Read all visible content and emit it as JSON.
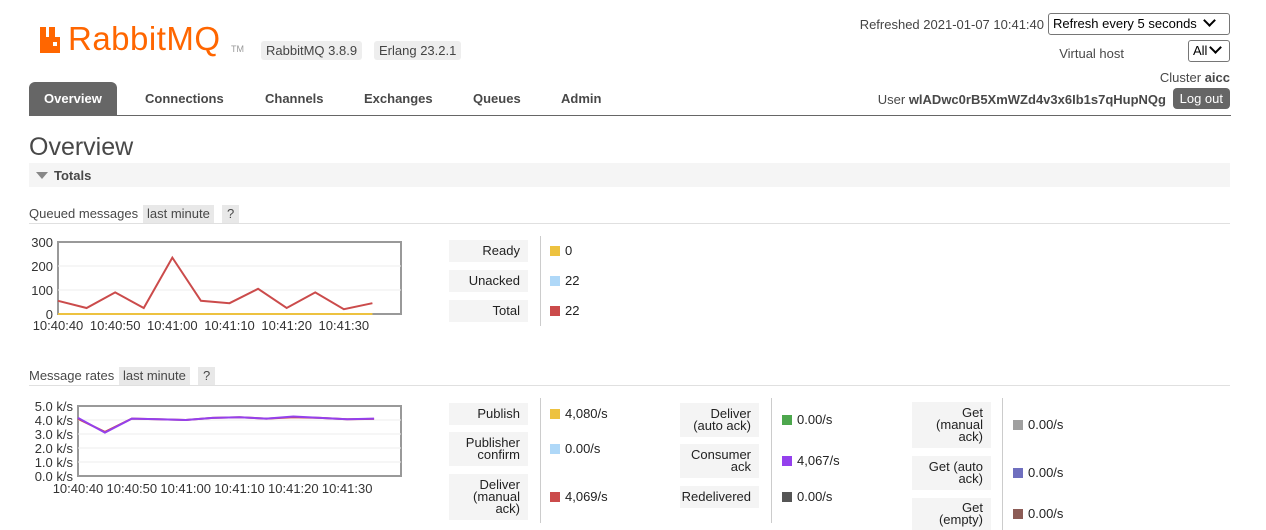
{
  "header": {
    "logo_text": "RabbitMQ",
    "logo_tm": "TM",
    "rabbitmq_version": "RabbitMQ 3.8.9",
    "erlang_version": "Erlang 23.2.1",
    "refreshed": "Refreshed 2021-01-07 10:41:40",
    "refresh_select": "Refresh every 5 seconds",
    "virtual_host_label": "Virtual host",
    "virtual_host_value": "All",
    "cluster_label": "Cluster",
    "cluster_name": "aicc",
    "user_label": "User",
    "user_name": "wlADwc0rB5XmWZd4v3x6Ib1s7qHupNQg",
    "logout_label": "Log out",
    "brand_color": "#ff6600"
  },
  "tabs": [
    {
      "label": "Overview",
      "active": true
    },
    {
      "label": "Connections"
    },
    {
      "label": "Channels"
    },
    {
      "label": "Exchanges"
    },
    {
      "label": "Queues"
    },
    {
      "label": "Admin"
    }
  ],
  "page": {
    "title": "Overview",
    "totals_label": "Totals"
  },
  "queued": {
    "label": "Queued messages",
    "range": "last minute",
    "help": "?",
    "stats": [
      {
        "label": "Ready",
        "value": "0",
        "color": "#edc240"
      },
      {
        "label": "Unacked",
        "value": "22",
        "color": "#afd8f8"
      },
      {
        "label": "Total",
        "value": "22",
        "color": "#cb4b4b"
      }
    ]
  },
  "rates": {
    "label": "Message rates",
    "range": "last minute",
    "help": "?",
    "col1": [
      {
        "label": "Publish",
        "value": "4,080/s",
        "color": "#edc240"
      },
      {
        "label": "Publisher confirm",
        "value": "0.00/s",
        "color": "#afd8f8"
      },
      {
        "label": "Deliver (manual ack)",
        "value": "4,069/s",
        "color": "#cb4b4b"
      }
    ],
    "col2": [
      {
        "label": "Deliver (auto ack)",
        "value": "0.00/s",
        "color": "#4da74d"
      },
      {
        "label": "Consumer ack",
        "value": "4,067/s",
        "color": "#9440ed"
      },
      {
        "label": "Redelivered",
        "value": "0.00/s",
        "color": "#555555"
      }
    ],
    "col3": [
      {
        "label": "Get (manual ack)",
        "value": "0.00/s",
        "color": "#a0a0a0"
      },
      {
        "label": "Get (auto ack)",
        "value": "0.00/s",
        "color": "#6f6fbf"
      },
      {
        "label": "Get (empty)",
        "value": "0.00/s",
        "color": "#8c5c56"
      }
    ]
  },
  "chart_data": [
    {
      "type": "line",
      "x": [
        "10:40:40",
        "10:40:45",
        "10:40:50",
        "10:40:55",
        "10:41:00",
        "10:41:05",
        "10:41:10",
        "10:41:15",
        "10:41:20",
        "10:41:25",
        "10:41:30",
        "10:41:35",
        "10:41:40"
      ],
      "x_ticks": [
        "10:40:40",
        "10:40:50",
        "10:41:00",
        "10:41:10",
        "10:41:20",
        "10:41:30"
      ],
      "y_ticks": [
        "300",
        "200",
        "100",
        "0"
      ],
      "ylim": [
        0,
        300
      ],
      "series": [
        {
          "values": [
            55,
            25,
            90,
            25,
            235,
            55,
            45,
            105,
            25,
            90,
            20,
            45
          ],
          "color": "#cb4b4b"
        },
        {
          "values": [
            0,
            0,
            0,
            0,
            0,
            0,
            0,
            0,
            0,
            0,
            0,
            0
          ],
          "color": "#edc240"
        },
        {
          "values": [
            0,
            0,
            0,
            0,
            0,
            0,
            0,
            0,
            0,
            0,
            0,
            0
          ],
          "color": "#afd8f8"
        }
      ]
    },
    {
      "type": "line",
      "x": [
        "10:40:40",
        "10:40:45",
        "10:40:50",
        "10:40:55",
        "10:41:00",
        "10:41:05",
        "10:41:10",
        "10:41:15",
        "10:41:20",
        "10:41:25",
        "10:41:30",
        "10:41:35",
        "10:41:40"
      ],
      "x_ticks": [
        "10:40:40",
        "10:40:50",
        "10:41:00",
        "10:41:10",
        "10:41:20",
        "10:41:30"
      ],
      "y_ticks": [
        "5.0 k/s",
        "4.0 k/s",
        "3.0 k/s",
        "2.0 k/s",
        "1.0 k/s",
        "0.0 k/s"
      ],
      "ylim": [
        0,
        5000
      ],
      "series": [
        {
          "values": [
            4150,
            3100,
            4100,
            4050,
            4000,
            4150,
            4200,
            4100,
            4250,
            4150,
            4050,
            4100
          ],
          "color": "#9440ed"
        },
        {
          "values": [
            4080,
            3150,
            4100,
            4050,
            4000,
            4150,
            4200,
            4100,
            4200,
            4150,
            4050,
            4080
          ],
          "color": "#cb4b4b"
        }
      ]
    }
  ]
}
